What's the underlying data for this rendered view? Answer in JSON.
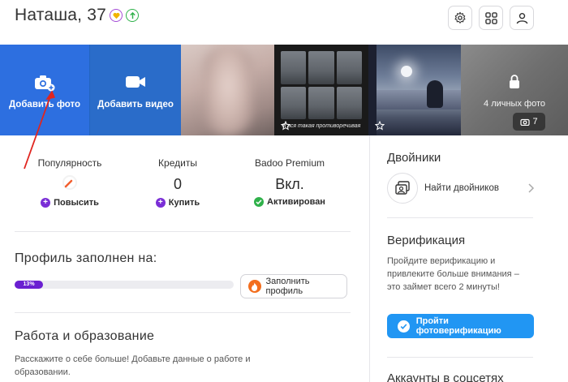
{
  "header": {
    "name": "Наташа, 37",
    "badges": [
      "heart-badge",
      "boost-up-badge"
    ],
    "buttons": [
      "settings-icon",
      "apps-grid-icon",
      "profile-icon"
    ]
  },
  "photos": {
    "add_photo": "Добавить фото",
    "add_video": "Добавить видео",
    "cats_caption": "Я вся такая противоречивая",
    "private_label": "4 личных фото",
    "private_count": "7"
  },
  "stats": {
    "popularity": {
      "title": "Популярность",
      "action": "Повысить"
    },
    "credits": {
      "title": "Кредиты",
      "value": "0",
      "action": "Купить"
    },
    "premium": {
      "title": "Badoo Premium",
      "value": "Вкл.",
      "action": "Активирован"
    }
  },
  "profile_fill": {
    "title": "Профиль заполнен на:",
    "percent": 13,
    "percent_label": "13%",
    "button": "Заполнить профиль"
  },
  "work": {
    "title": "Работа и образование",
    "text": "Расскажите о себе больше! Добавьте данные о работе и образовании."
  },
  "doubles": {
    "title": "Двойники",
    "find": "Найти двойников"
  },
  "verification": {
    "title": "Верификация",
    "text": "Пройдите верификацию и привлеките больше внимания – это займет всего 2 минуты!",
    "button": "Пройти фотоверификацию"
  },
  "social": {
    "title": "Аккаунты в соцсетях"
  },
  "colors": {
    "add_photo_bg": "#2d6fe0",
    "add_video_bg": "#2a6cc9",
    "progress": "#6a1fd1",
    "verify_button": "#2196f3",
    "annotation_arrow": "#e0251f"
  }
}
